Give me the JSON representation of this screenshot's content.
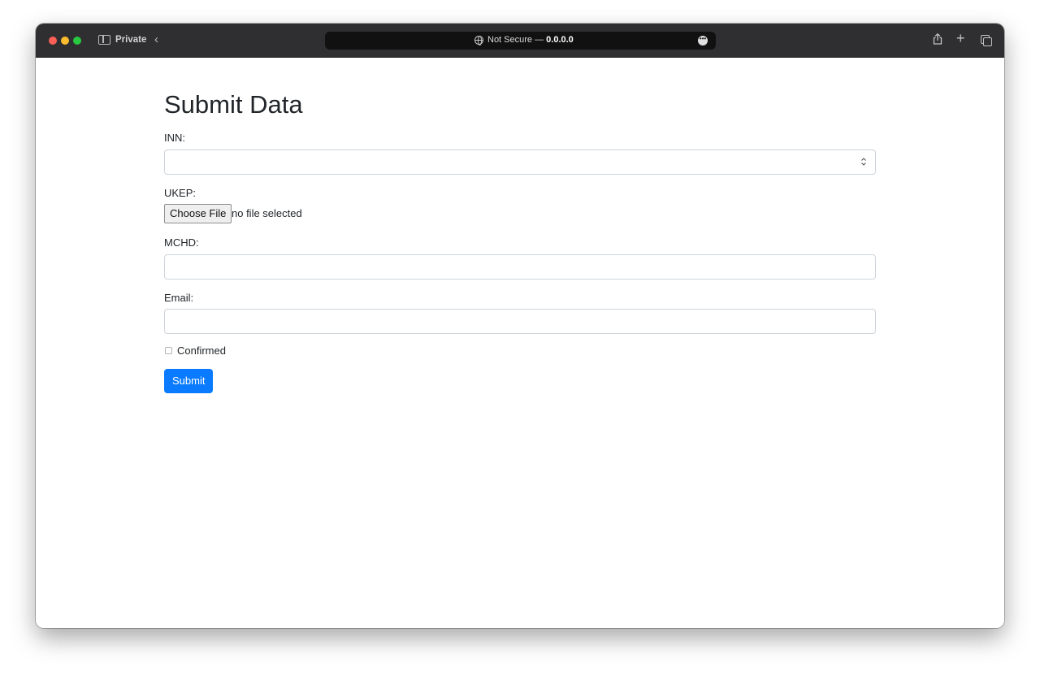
{
  "browser": {
    "private_label": "Private",
    "address": {
      "security_label": "Not Secure —",
      "host": "0.0.0.0"
    }
  },
  "form": {
    "title": "Submit Data",
    "inn": {
      "label": "INN:",
      "value": ""
    },
    "ukep": {
      "label": "UKEP:",
      "button_label": "Choose File",
      "status": "no file selected"
    },
    "mchd": {
      "label": "MCHD:",
      "value": ""
    },
    "email": {
      "label": "Email:",
      "value": ""
    },
    "confirmed": {
      "label": "Confirmed",
      "checked": false
    },
    "submit_label": "Submit"
  },
  "colors": {
    "accent": "#0a7bff",
    "titlebar": "#2f2f31",
    "text": "#212529",
    "input_border": "#ced4da"
  }
}
